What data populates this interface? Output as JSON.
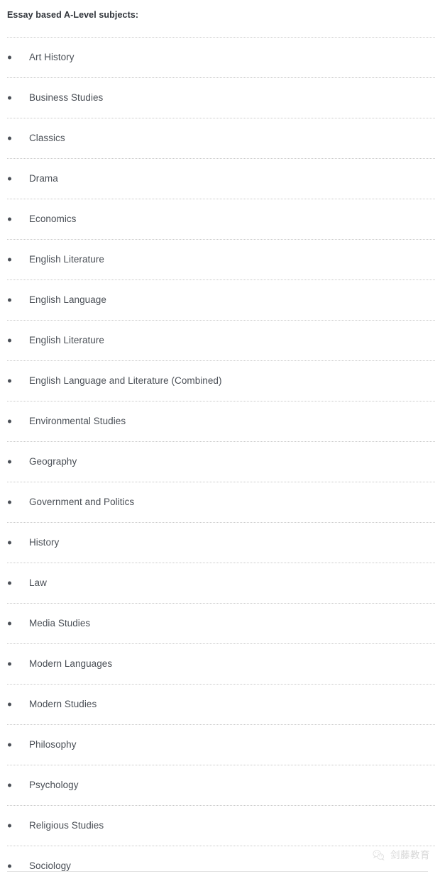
{
  "document": {
    "heading": "Essay based A-Level subjects:",
    "subjects": [
      "Art History",
      "Business Studies",
      "Classics",
      "Drama",
      "Economics",
      "English Literature",
      "English Language",
      "English Literature",
      "English Language and Literature (Combined)",
      "Environmental Studies",
      "Geography",
      "Government and Politics",
      "History",
      "Law",
      "Media Studies",
      "Modern Languages",
      "Modern Studies",
      "Philosophy",
      "Psychology",
      "Religious Studies",
      "Sociology"
    ]
  },
  "watermark": {
    "text": "剑藤教育",
    "icon": "wechat-logo-icon"
  },
  "colors": {
    "heading_text": "#31353b",
    "body_text": "#4a4f56",
    "divider": "#c9c9c9",
    "bottom_rule": "#e2e2e2",
    "watermark_text": "#b8b8b8",
    "background": "#ffffff"
  }
}
